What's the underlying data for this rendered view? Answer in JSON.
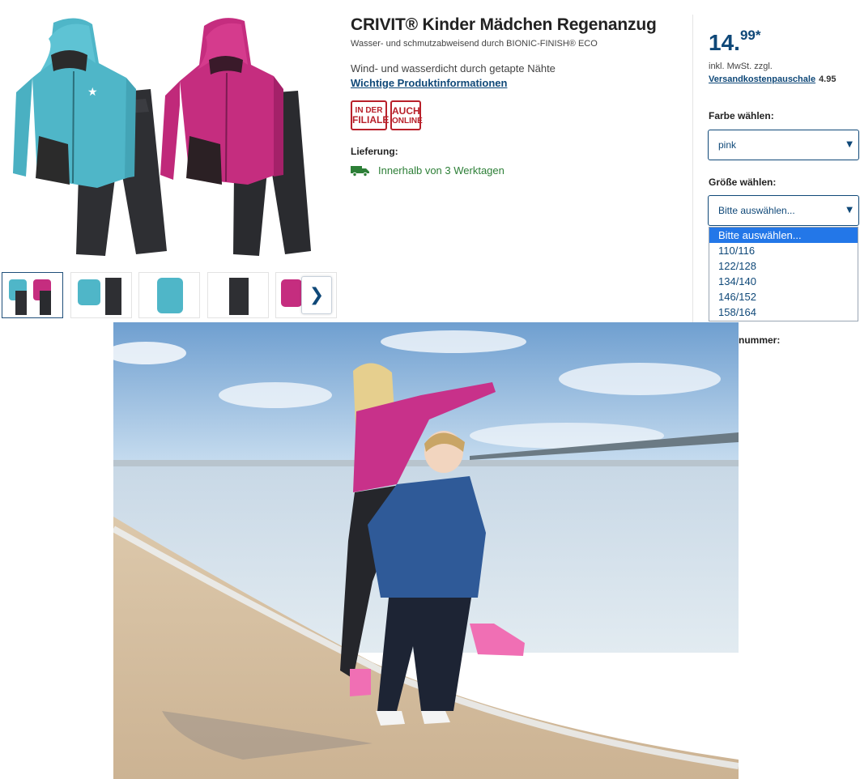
{
  "product": {
    "title": "CRIVIT® Kinder Mädchen Regenanzug",
    "subtitle": "Wasser- und schmutzabweisend durch BIONIC-FINISH® ECO",
    "feature": "Wind- und wasserdicht durch getapte Nähte",
    "info_link": "Wichtige Produktinformationen",
    "badges": [
      {
        "line1": "IN DER",
        "line2": "FILIALE"
      },
      {
        "line1": "AUCH",
        "line2": "ONLINE"
      }
    ],
    "delivery_label": "Lieferung:",
    "delivery_text": "Innerhalb von 3 Werktagen"
  },
  "gallery": {
    "next_label": "❯",
    "thumb_count": 5,
    "active_index": 0
  },
  "buybox": {
    "price_int": "14.",
    "price_dec": "99*",
    "tax_note": "inkl. MwSt. zzgl.",
    "shipping_link": "Versandkostenpauschale",
    "shipping_cost": "4.95",
    "color_label": "Farbe wählen:",
    "color_value": "pink",
    "size_label": "Größe wählen:",
    "size_value": "Bitte auswählen...",
    "size_options": [
      "Bitte auswählen...",
      "110/116",
      "122/128",
      "134/140",
      "146/152",
      "158/164"
    ],
    "partial_label": "nummer:",
    "arrow": "▼"
  },
  "colors": {
    "brand_blue": "#0f4878",
    "badge_red": "#b8202a",
    "delivery_green": "#2d7f37",
    "selection_blue": "#2377e8"
  }
}
